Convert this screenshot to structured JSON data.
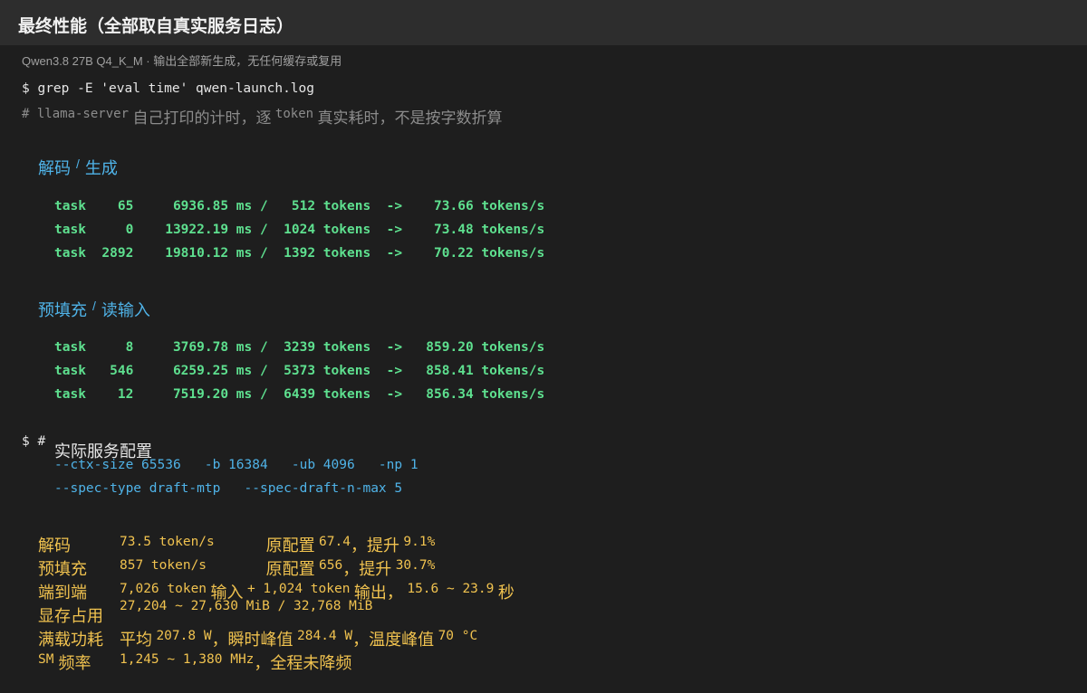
{
  "header": {
    "title": "最终性能（全部取自真实服务日志）",
    "subtitle": "Qwen3.8 27B Q4_K_M · 输出全部新生成，无任何缓存或复用"
  },
  "terminal": {
    "command": "$ grep -E 'eval time' qwen-launch.log",
    "comment": {
      "prefix": "# llama-server",
      "text1": "自己打印的计时，逐",
      "token": "token",
      "text2": "真实耗时，不是按字数折算"
    },
    "decode_section": {
      "a": "解码",
      "slash": "/",
      "b": "生成"
    },
    "decode_rows": [
      "task    65     6936.85 ms /   512 tokens  ->    73.66 tokens/s",
      "task     0    13922.19 ms /  1024 tokens  ->    73.48 tokens/s",
      "task  2892    19810.12 ms /  1392 tokens  ->    70.22 tokens/s"
    ],
    "prefill_section": {
      "a": "预填充",
      "slash": "/",
      "b": "读输入"
    },
    "prefill_rows": [
      "task     8     3769.78 ms /  3239 tokens  ->   859.20 tokens/s",
      "task   546     6259.25 ms /  5373 tokens  ->   858.41 tokens/s",
      "task    12     7519.20 ms /  6439 tokens  ->   856.34 tokens/s"
    ],
    "config_prompt": "$ #",
    "config_title": "实际服务配置",
    "config_lines": [
      "--ctx-size 65536   -b 16384   -ub 4096   -np 1",
      "--spec-type draft-mtp   --spec-draft-n-max 5"
    ]
  },
  "stats": {
    "decode": {
      "label": "解码",
      "value": "73.5 token/s      ",
      "orig_label": "原配置",
      "orig": "67.4",
      "sep": "，",
      "up_label": "提升",
      "up": "9.1%"
    },
    "prefill": {
      "label": "预填充",
      "value": "857 token/s       ",
      "orig_label": "原配置",
      "orig": "656",
      "sep": "，",
      "up_label": "提升",
      "up": "30.7%"
    },
    "e2e": {
      "label": "端到端",
      "in_tokens": "7,026 token",
      "in_label": "输入",
      "plus": "+ 1,024 token",
      "out_label": "输出，",
      "time": "15.6 ~ 23.9",
      "unit": "秒"
    },
    "vram": {
      "label": "显存占用",
      "value": "27,204 ~ 27,630 MiB / 32,768 MiB"
    },
    "power": {
      "label": "满载功耗",
      "avg_label": "平均",
      "avg": "207.8 W",
      "peak_label": "，瞬时峰值",
      "peak": "284.4 W",
      "temp_label": "，温度峰值",
      "temp": "70 °C"
    },
    "freq": {
      "label_sm": "SM",
      "label": "频率",
      "value": "1,245 ~ 1,380 MHz",
      "note": "，全程未降频"
    }
  }
}
